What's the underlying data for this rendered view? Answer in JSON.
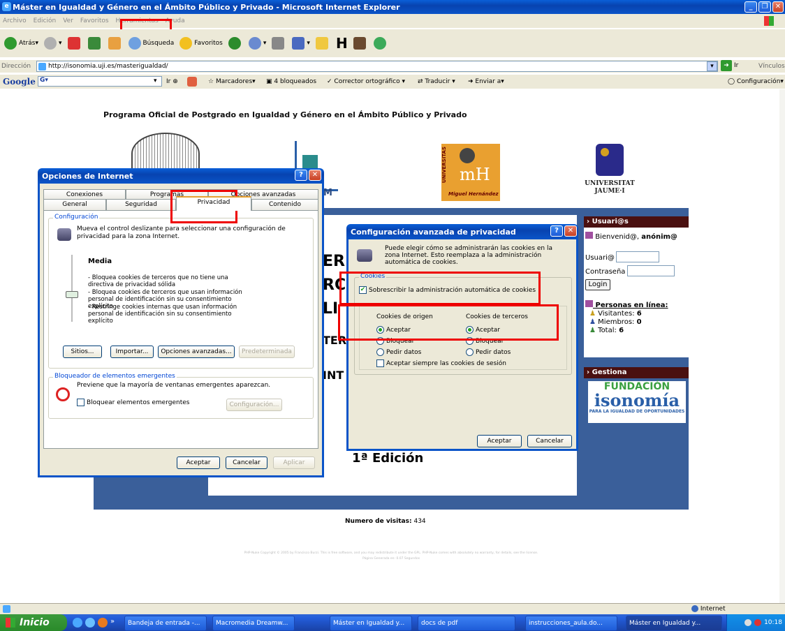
{
  "browser": {
    "title": "Máster en Igualdad y Género en el Ámbito Público y Privado - Microsoft Internet Explorer",
    "menu": [
      "Archivo",
      "Edición",
      "Ver",
      "Favoritos",
      "Herramientas",
      "Ayuda"
    ],
    "back_label": "Atrás",
    "search_label": "Búsqueda",
    "favorites_label": "Favoritos",
    "address_label": "Dirección",
    "address_value": "http://isonomia.uji.es/masterigualdad/",
    "go_label": "Ir",
    "links_label": "Vínculos"
  },
  "google_bar": {
    "logo": "Google",
    "g_label": "G",
    "go_label": "Ir",
    "bookmarks": "Marcadores",
    "blocked": "4 bloqueados",
    "spell": "Corrector ortográfico",
    "translate": "Traducir",
    "send": "Enviar a",
    "config": "Configuración"
  },
  "page": {
    "heading": "Programa Oficial de Postgrado en Igualdad y Género en el Ámbito Público y Privado",
    "umh_text": "UNIVERSITAS",
    "umh_caption": "Miguel Hernández",
    "uji_line1": "UNIVERSITAT",
    "uji_line2": "JAUME·I",
    "partial_m": "M",
    "partial_lines": [
      "ER",
      "RC",
      "LI",
      "TER",
      "INT"
    ],
    "edition": "1ª Edición",
    "visits_label": "Numero de visitas:",
    "visits_value": "434",
    "footer_line1": "PHP-Nuke Copyright © 2005 by Francisco Burzi. This is free software, and you may redistribute it under the GPL. PHP-Nuke comes with absolutely no warranty, for details, see the license.",
    "footer_line2": "Página Generada en: 0.07 Segundos"
  },
  "sidebar": {
    "users_title": "Usuari@s",
    "welcome": "Bienvenid@,",
    "welcome_name": "anónim@",
    "user_label": "Usuari@",
    "pass_label": "Contraseña",
    "login_button": "Login",
    "online_title": "Personas en línea:",
    "visitors_label": "Visitantes:",
    "visitors_value": "6",
    "members_label": "Miembros:",
    "members_value": "0",
    "total_label": "Total:",
    "total_value": "6",
    "gestiona_title": "Gestiona",
    "fund_line1": "FUNDACIÓN",
    "fund_line2": "isonomía",
    "fund_line3": "PARA LA IGUALDAD DE OPORTUNIDADES"
  },
  "internet_options": {
    "title": "Opciones de Internet",
    "tabs_back": [
      "Conexiones",
      "Programas",
      "Opciones avanzadas"
    ],
    "tabs_front": [
      "General",
      "Seguridad",
      "Privacidad",
      "Contenido"
    ],
    "config_group": "Configuración",
    "config_desc": "Mueva el control deslizante para seleccionar una configuración de privacidad para la zona Internet.",
    "level": "Media",
    "bullets": [
      "- Bloquea cookies de terceros que no tiene una directiva de privacidad sólida",
      "- Bloquea cookies de terceros que usan información personal de identificación sin su consentimiento explícito",
      "- Restringe cookies internas que usan información personal de identificación sin su consentimiento explícito"
    ],
    "btn_sites": "Sitios...",
    "btn_import": "Importar...",
    "btn_advanced": "Opciones avanzadas...",
    "btn_default": "Predeterminada",
    "popup_group": "Bloqueador de elementos emergentes",
    "popup_desc": "Previene que la mayoría de ventanas emergentes aparezcan.",
    "popup_check": "Bloquear elementos emergentes",
    "btn_popup_config": "Configuración...",
    "btn_ok": "Aceptar",
    "btn_cancel": "Cancelar",
    "btn_apply": "Aplicar"
  },
  "advanced_privacy": {
    "title": "Configuración avanzada de privacidad",
    "desc": "Puede elegir cómo se administrarán las cookies en la zona Internet. Esto reemplaza a la administración automática de cookies.",
    "group": "Cookies",
    "override": "Sobrescribir la administración automática de cookies",
    "first_party": "Cookies de origen",
    "third_party": "Cookies de terceros",
    "accept": "Aceptar",
    "block": "Bloquear",
    "prompt": "Pedir datos",
    "session": "Aceptar siempre las cookies de sesión",
    "btn_ok": "Aceptar",
    "btn_cancel": "Cancelar"
  },
  "statusbar": {
    "zone": "Internet"
  },
  "taskbar": {
    "start": "Inicio",
    "tasks": [
      "Bandeja de entrada -...",
      "Macromedia Dreamw...",
      "Máster en Igualdad y...",
      "docs de pdf",
      "instrucciones_aula.do...",
      "Máster en Igualdad y..."
    ],
    "clock": "10:18"
  },
  "colors": {
    "xp_blue": "#0a54c8",
    "page_blue": "#3a5f9a",
    "sidebar_header": "#4a1010",
    "highlight": "#ee0000"
  }
}
